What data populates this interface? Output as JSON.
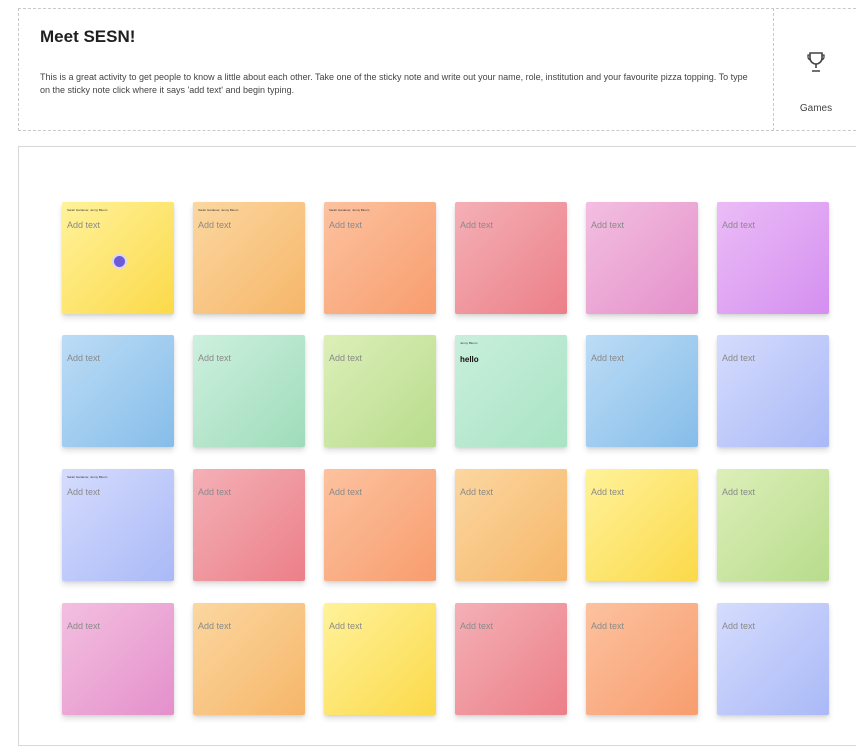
{
  "activity": {
    "title": "Meet SESN!",
    "description": "This is a great activity to get people to know a little about each other. Take one of the sticky note and write out your name, role, institution and your favourite pizza topping. To type on the  sticky note  click where it says 'add text' and begin typing."
  },
  "sidebar": {
    "games_label": "Games",
    "games_icon": "trophy-icon"
  },
  "notes": [
    {
      "author": "Sarah Gardener, Jenny Bloom",
      "text": "Add text",
      "color": "#fbd949"
    },
    {
      "author": "Sarah Gardener, Jenny Bloom",
      "text": "Add text",
      "color": "#f6b669"
    },
    {
      "author": "Sarah Gardener, Jenny Bloom",
      "text": "Add text",
      "color": "#f89d6e"
    },
    {
      "author": "",
      "text": "Add text",
      "color": "#ec7f88"
    },
    {
      "author": "",
      "text": "Add text",
      "color": "#e490cb"
    },
    {
      "author": "",
      "text": "Add text",
      "color": "#d48ff0"
    },
    {
      "author": "",
      "text": "Add text",
      "color": "#86bde9"
    },
    {
      "author": "",
      "text": "Add text",
      "color": "#9fdcbb"
    },
    {
      "author": "",
      "text": "Add text",
      "color": "#b8dc8c"
    },
    {
      "author": "Jenny Bloom",
      "text": "hello",
      "color": "#a9e3c4"
    },
    {
      "author": "",
      "text": "Add text",
      "color": "#86bde9"
    },
    {
      "author": "",
      "text": "Add text",
      "color": "#aab9f7"
    },
    {
      "author": "Sarah Gardener, Jenny Bloom",
      "text": "Add text",
      "color": "#aab9f7"
    },
    {
      "author": "",
      "text": "Add text",
      "color": "#ec7f88"
    },
    {
      "author": "",
      "text": "Add text",
      "color": "#f89d6e"
    },
    {
      "author": "",
      "text": "Add text",
      "color": "#f6b669"
    },
    {
      "author": "",
      "text": "Add text",
      "color": "#fbd949"
    },
    {
      "author": "",
      "text": "Add text",
      "color": "#b8dc8c"
    },
    {
      "author": "",
      "text": "Add text",
      "color": "#e490cb"
    },
    {
      "author": "",
      "text": "Add text",
      "color": "#f6b669"
    },
    {
      "author": "",
      "text": "Add text",
      "color": "#fbd949"
    },
    {
      "author": "",
      "text": "Add text",
      "color": "#ec7f88"
    },
    {
      "author": "",
      "text": "Add text",
      "color": "#f89d6e"
    },
    {
      "author": "",
      "text": "Add text",
      "color": "#aab9f7"
    }
  ]
}
